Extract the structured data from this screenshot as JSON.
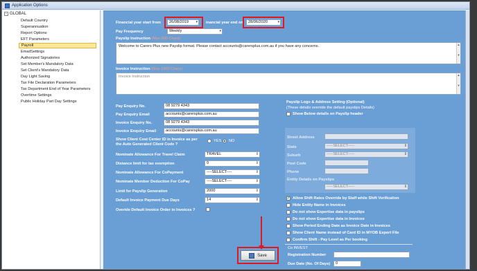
{
  "window": {
    "title": "Application Options"
  },
  "tree": {
    "root": "GLOBAL",
    "items": [
      {
        "label": "Default Country",
        "selected": false
      },
      {
        "label": "Superannuation",
        "selected": false
      },
      {
        "label": "Report Options",
        "selected": false
      },
      {
        "label": "EFT Parameters",
        "selected": false
      },
      {
        "label": "PayrolI",
        "selected": true
      },
      {
        "label": "EmailSettings",
        "selected": false
      },
      {
        "label": "Authorized Signatories",
        "selected": false
      },
      {
        "label": "Set Member's Mandatory Data",
        "selected": false
      },
      {
        "label": "Set Client's Mandatory Data",
        "selected": false
      },
      {
        "label": "Day Light Saving",
        "selected": false
      },
      {
        "label": "Tax File Declaration Parameters",
        "selected": false
      },
      {
        "label": "Tax Department End of Year Parameters",
        "selected": false
      },
      {
        "label": "Overtime Settings",
        "selected": false
      },
      {
        "label": "Public Holiday Part Day Settings",
        "selected": false
      }
    ]
  },
  "payroll": {
    "fy_start_label": "Financial year start from",
    "fy_start_value": "26/08/2019",
    "fy_end_label": "inancial year end on",
    "fy_end_value": "28/06/2020",
    "pay_frequency_label": "Pay Frequency",
    "pay_frequency_value": "Weekly",
    "payslip_instruction_label": "Payslip Instruction",
    "payslip_instruction_hint": "(Max 500 Chars)",
    "payslip_instruction_value": "Welcome to Carers Plus new Payslip format. Please contact accounts@carersplus.com.au if you have any concerns.",
    "invoice_instruction_label": "Invoice Instruction",
    "invoice_instruction_hint": "(Max 1000 Chars)",
    "invoice_instruction_placeholder": "Invoice Instruction",
    "pay_enquiry_no_label": "Pay Enquiry No.",
    "pay_enquiry_no_value": "08 9279 4343",
    "pay_enquiry_email_label": "Pay Enquiry Email",
    "pay_enquiry_email_value": "accounts@carersplus.com.au",
    "invoice_enquiry_no_label": "Invoice Enquiry No.",
    "invoice_enquiry_no_value": "08 9279 4343",
    "invoice_enquiry_email_label": "Invoice Enquiry Email",
    "invoice_enquiry_email_value": "accounts@carersplus.com.au",
    "cost_center_label_1": "Show Client Cost Center ID in Invoice as per",
    "cost_center_label_2": "the Auto Generated Client Code ?",
    "radio_yes": "YES",
    "radio_no": "NO",
    "travel_claim_label": "Nominate Allowance For Travel Claim",
    "travel_claim_value": "TRAVEL",
    "distance_limit_label": "Distance limit for tax exemption",
    "distance_limit_value": "0",
    "copayment_label": "Nominate Allowance For CoPayment",
    "copayment_value": "----SELECT----",
    "member_deduction_label": "Nominate Member Deduction For CoPay",
    "member_deduction_value": "----SELECT----",
    "payslip_limit_label": "Limit for Payslip Generation",
    "payslip_limit_value": "2000",
    "due_days_label": "Default Invoice Payment Due Days",
    "due_days_value": "14",
    "override_order_label": "Overide Default Invoice Order in Invoices ?",
    "save_label": "Save"
  },
  "logo_section": {
    "title": "Payslip Logo & Address Setting (Optional)",
    "subtitle": "(These details override the default payslips Details)",
    "show_below_label": "Show Below details on Payslip header",
    "street_label": "Street Address",
    "state_label": "State",
    "state_value": "-----SELECT-----",
    "suburb_label": "Suburb",
    "suburb_value": "-----SELECT-----",
    "postcode_label": "Post Code",
    "phone_label": "Phone",
    "entity_label": "Entity Details on Payslips",
    "entity_value": "-----SELECT-----"
  },
  "checkboxes": [
    {
      "label": "Allow Shift Rates Override by Staff while Shift Verification",
      "checked": true
    },
    {
      "label": "Hide Entity Name in Invoices",
      "checked": false
    },
    {
      "label": "Do not show Expertise data in payslips",
      "checked": false
    },
    {
      "label": "Do not show Expertise data in Invoices",
      "checked": false
    },
    {
      "label": "Show Period Ending Date as Invoice Date in Invoices",
      "checked": false
    },
    {
      "label": "Show Client Name instead of Card ID in MYOB Export File",
      "checked": false
    },
    {
      "label": "Confirm Shift - Pay Level as Per booking",
      "checked": false
    }
  ],
  "registration": {
    "co_label": "Co INVEST",
    "reg_number_label": "Registration Number",
    "due_date_label": "Due Date (No. Of Days)",
    "due_date_value": "0"
  },
  "colors": {
    "panel": "#6a9fd6",
    "highlight": "#e0181e",
    "selected": "#ffe79c"
  },
  "icons": [
    "calendar-icon",
    "dropdown-arrow-icon",
    "save-disk-icon",
    "checkbox-icon",
    "radio-icon",
    "tree-collapse-icon"
  ]
}
